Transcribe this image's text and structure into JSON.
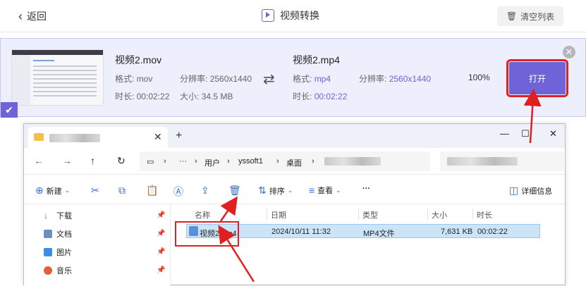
{
  "topbar": {
    "back_label": "返回",
    "title": "视频转换",
    "clear_label": "清空列表"
  },
  "conversion": {
    "source": {
      "name": "视频2.mov",
      "format_label": "格式:",
      "format": "mov",
      "resolution_label": "分辨率:",
      "resolution": "2560x1440",
      "duration_label": "时长:",
      "duration": "00:02:22",
      "size_label": "大小:",
      "size": "34.5 MB"
    },
    "output": {
      "name": "视频2.mp4",
      "format_label": "格式:",
      "format": "mp4",
      "resolution_label": "分辨率:",
      "resolution": "2560x1440",
      "duration_label": "时长:",
      "duration": "00:02:22"
    },
    "progress_text": "100%",
    "progress": 1.0,
    "open_label": "打开"
  },
  "explorer": {
    "new_tab": "+",
    "address": {
      "more": "···",
      "seg1": "用户",
      "seg2": "yssoft1",
      "seg3": "桌面"
    },
    "toolbar": {
      "new_label": "新建",
      "sort_label": "排序",
      "view_label": "查看",
      "more": "···",
      "details_label": "详细信息"
    },
    "sidebar": [
      {
        "label": "下载",
        "icon": "download-icon",
        "color": "#3a7bd5"
      },
      {
        "label": "文档",
        "icon": "document-icon",
        "color": "#6a8fc4"
      },
      {
        "label": "图片",
        "icon": "picture-icon",
        "color": "#3a8ee6"
      },
      {
        "label": "音乐",
        "icon": "music-icon",
        "color": "#e0603a"
      }
    ],
    "columns": {
      "name": "名称",
      "date": "日期",
      "type": "类型",
      "size": "大小",
      "duration": "时长"
    },
    "files": [
      {
        "name": "视频2.mp4",
        "date": "2024/10/11 11:32",
        "type": "MP4文件",
        "size": "7,631 KB",
        "duration": "00:02:22"
      }
    ]
  },
  "colors": {
    "accent": "#6f63d8",
    "annotation": "#e02020",
    "row_bg": "#eeeffc",
    "selection": "#cce4f7"
  }
}
